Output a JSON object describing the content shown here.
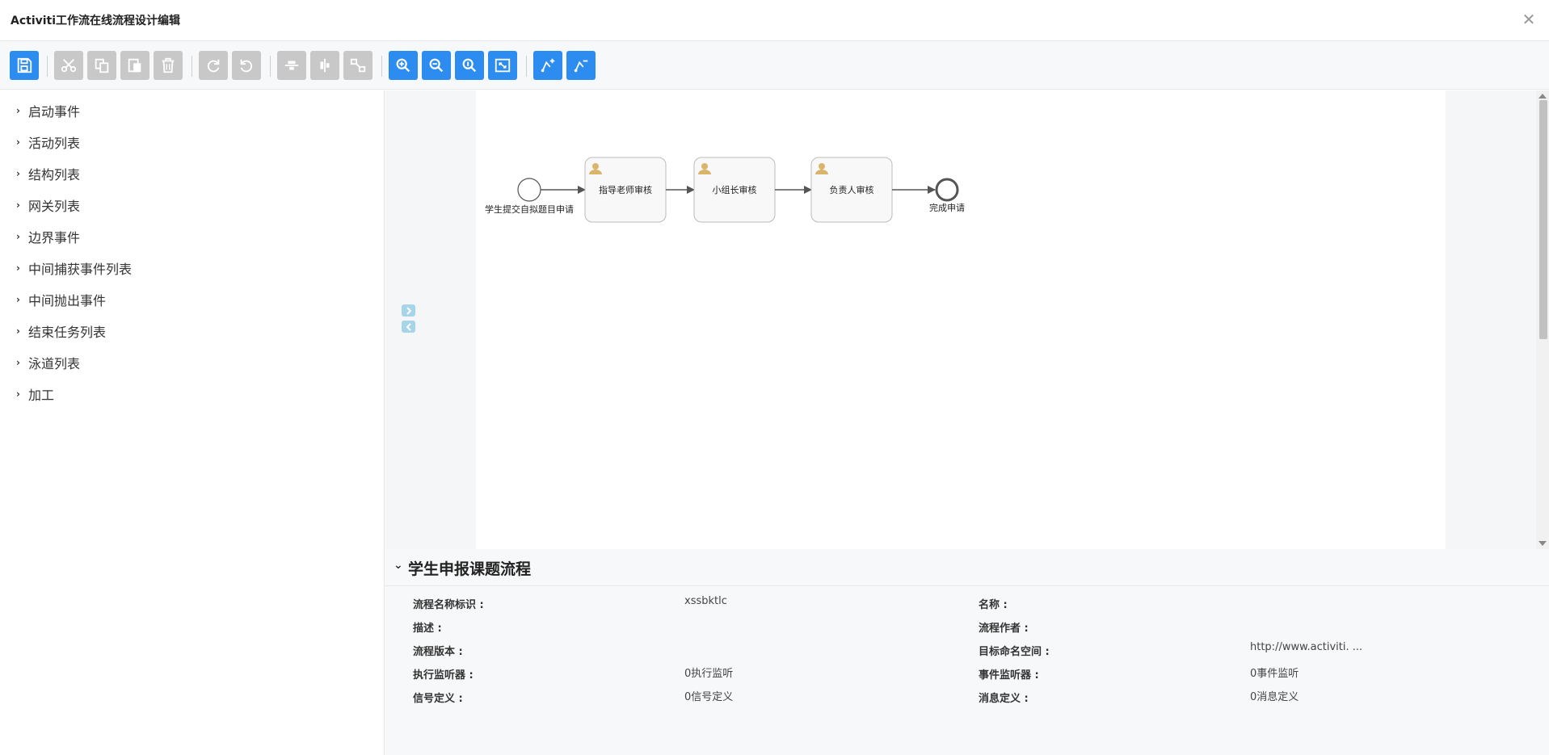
{
  "window": {
    "title": "Activiti工作流在线流程设计编辑",
    "close_glyph": "✕"
  },
  "toolbar": {
    "buttons": [
      {
        "icon": "save-icon",
        "state": "active"
      },
      {
        "icon": "cut-icon",
        "state": "disabled"
      },
      {
        "icon": "copy-icon",
        "state": "disabled"
      },
      {
        "icon": "paste-icon",
        "state": "disabled"
      },
      {
        "icon": "delete-icon",
        "state": "disabled"
      },
      {
        "icon": "redo-icon",
        "state": "disabled"
      },
      {
        "icon": "undo-icon",
        "state": "disabled"
      },
      {
        "icon": "align-vertical-icon",
        "state": "disabled"
      },
      {
        "icon": "align-horizontal-icon",
        "state": "disabled"
      },
      {
        "icon": "same-size-icon",
        "state": "disabled"
      },
      {
        "icon": "zoom-in-icon",
        "state": "active"
      },
      {
        "icon": "zoom-out-icon",
        "state": "active"
      },
      {
        "icon": "zoom-actual-icon",
        "state": "active"
      },
      {
        "icon": "zoom-fit-icon",
        "state": "active"
      },
      {
        "icon": "add-bendpoint-icon",
        "state": "active"
      },
      {
        "icon": "remove-bendpoint-icon",
        "state": "active"
      }
    ]
  },
  "palette": {
    "items": [
      {
        "label": "启动事件"
      },
      {
        "label": "活动列表"
      },
      {
        "label": "结构列表"
      },
      {
        "label": "网关列表"
      },
      {
        "label": "边界事件"
      },
      {
        "label": "中间捕获事件列表"
      },
      {
        "label": "中间抛出事件"
      },
      {
        "label": "结束任务列表"
      },
      {
        "label": "泳道列表"
      },
      {
        "label": "加工"
      }
    ]
  },
  "diagram": {
    "start_event": {
      "label": "学生提交自拟题目申请"
    },
    "tasks": [
      {
        "label": "指导老师审核",
        "icon": "user-icon"
      },
      {
        "label": "小组长审核",
        "icon": "user-icon"
      },
      {
        "label": "负责人审核",
        "icon": "user-icon"
      }
    ],
    "end_event": {
      "label": "完成申请"
    }
  },
  "properties": {
    "title": "学生申报课题流程",
    "fields": {
      "process_id_label": "流程名称标识 :",
      "process_id_value": "xssbktlc",
      "name_label": "名称 :",
      "name_value": "",
      "description_label": "描述 :",
      "description_value": "",
      "author_label": "流程作者 :",
      "author_value": "",
      "version_label": "流程版本 :",
      "version_value": "",
      "namespace_label": "目标命名空间 :",
      "namespace_value": "http://www.activiti. ...",
      "exec_listener_label": "执行监听器 :",
      "exec_listener_value": "0执行监听",
      "event_listener_label": "事件监听器 :",
      "event_listener_value": "0事件监听",
      "signal_label": "信号定义 :",
      "signal_value": "0信号定义",
      "message_label": "消息定义 :",
      "message_value": "0消息定义"
    }
  }
}
